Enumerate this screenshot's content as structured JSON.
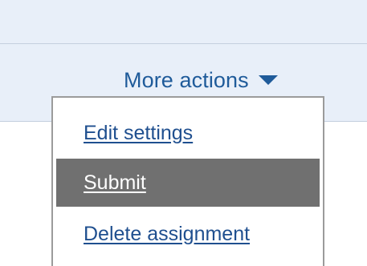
{
  "toolbar": {
    "more_actions_label": "More actions",
    "caret_icon": "caret-down-icon"
  },
  "menu": {
    "items": [
      {
        "label": "Edit settings",
        "highlighted": false
      },
      {
        "label": "Submit",
        "highlighted": true
      },
      {
        "label": "Delete assignment",
        "highlighted": false
      }
    ]
  },
  "colors": {
    "band_background": "#e8eff9",
    "link_blue": "#1f5b9a",
    "highlight_gray": "#707070",
    "menu_border": "#9b9b9b"
  }
}
